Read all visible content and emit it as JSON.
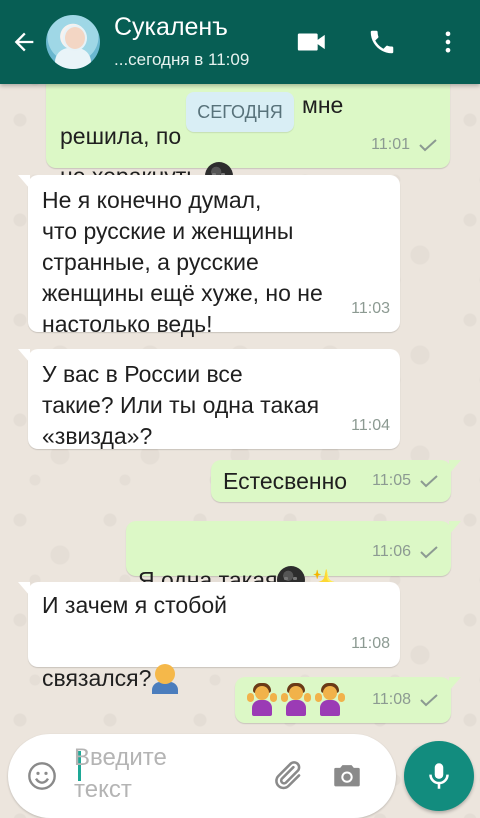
{
  "header": {
    "contact_name": "Сукаленъ",
    "status": "...сегодня в 11:09",
    "colors": {
      "bar": "#075e54",
      "accent": "#128c7e"
    }
  },
  "date_chip": "СЕГОДНЯ",
  "messages": [
    {
      "direction": "outgoing",
      "text_top": "решила, по",
      "text_top_after": "мне",
      "text_bottom": "не херакнуть.",
      "trailing_emoji": "new-moon-face",
      "time": "11:01",
      "status": "read"
    },
    {
      "direction": "incoming",
      "text": "Не я конечно думал,\nчто русские и женщины\nстранные, а русские\nженщины ещё хуже, но не\nнастолько ведь!",
      "time": "11:03"
    },
    {
      "direction": "incoming",
      "text": "У вас в России все\nтакие? Или ты одна такая\n«звизда»?",
      "time": "11:04"
    },
    {
      "direction": "outgoing",
      "text": "Естесвенно",
      "time": "11:05",
      "status": "read"
    },
    {
      "direction": "outgoing",
      "text": "Я одна такая",
      "emojis": [
        "new-moon-face",
        "sparkles"
      ],
      "time": "11:06",
      "status": "read"
    },
    {
      "direction": "incoming",
      "text_line1": "И зачем я стобой",
      "text_line2": "связался?",
      "emojis": [
        "man-facepalming"
      ],
      "time": "11:08"
    },
    {
      "direction": "outgoing",
      "emojis": [
        "woman-shrugging",
        "woman-shrugging",
        "woman-shrugging"
      ],
      "time": "11:08",
      "status": "read"
    }
  ],
  "composer": {
    "placeholder": "Введите\nтекст",
    "placeholder_line1": "Введите",
    "placeholder_line2": "текст",
    "icons": [
      "emoji-icon",
      "attach-icon",
      "camera-icon",
      "mic-icon"
    ]
  }
}
